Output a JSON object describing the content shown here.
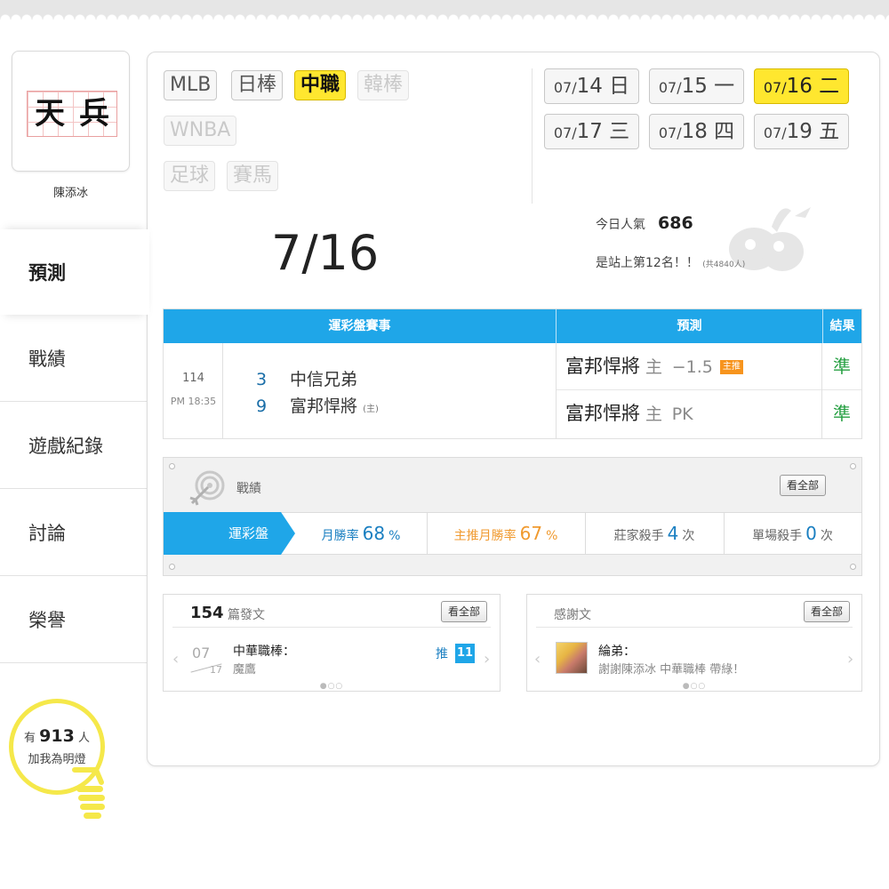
{
  "profile": {
    "avatar_chars": [
      "天",
      "兵"
    ],
    "name": "陳添冰"
  },
  "nav": [
    {
      "label": "預測",
      "active": true
    },
    {
      "label": "戰績"
    },
    {
      "label": "遊戲紀錄"
    },
    {
      "label": "討論"
    },
    {
      "label": "榮譽"
    }
  ],
  "fans": {
    "prefix": "有",
    "count": "913",
    "unit": "人",
    "caption": "加我為明燈"
  },
  "leagues": [
    {
      "label": "MLB",
      "state": "normal"
    },
    {
      "label": "日棒",
      "state": "normal"
    },
    {
      "label": "中職",
      "state": "active"
    },
    {
      "label": "韓棒",
      "state": "disabled"
    },
    {
      "label": "WNBA",
      "state": "disabled"
    },
    {
      "label": "足球",
      "state": "disabled"
    },
    {
      "label": "賽馬",
      "state": "disabled"
    }
  ],
  "dates": [
    {
      "m": "07/",
      "d": "14",
      "w": " 日",
      "active": false
    },
    {
      "m": "07/",
      "d": "15",
      "w": " 一",
      "active": false
    },
    {
      "m": "07/",
      "d": "16",
      "w": " 二",
      "active": true
    },
    {
      "m": "07/",
      "d": "17",
      "w": " 三",
      "active": false
    },
    {
      "m": "07/",
      "d": "18",
      "w": " 四",
      "active": false
    },
    {
      "m": "07/",
      "d": "19",
      "w": " 五",
      "active": false
    }
  ],
  "selected_date": "7/16",
  "popularity": {
    "label": "今日人氣",
    "value": "686",
    "rank_text": "是站上第12名！！",
    "total_text": "(共4840人)"
  },
  "game_table": {
    "headers": {
      "event": "運彩盤賽事",
      "prediction": "預測",
      "result": "結果"
    },
    "game": {
      "id": "114",
      "time": "PM 18:35",
      "away": {
        "score": "3",
        "team": "中信兄弟"
      },
      "home": {
        "score": "9",
        "team": "富邦悍將",
        "tag": "(主)"
      }
    },
    "predictions": [
      {
        "team": "富邦悍將",
        "side": "主",
        "line": "−1.5",
        "badge": "主推",
        "result": "準"
      },
      {
        "team": "富邦悍將",
        "side": "主",
        "line": "PK",
        "badge": "",
        "result": "準"
      }
    ]
  },
  "record": {
    "title": "戰績",
    "view_all": "看全部",
    "tab": "運彩盤",
    "stats": [
      {
        "label": "月勝率",
        "value": "68",
        "unit": "%"
      },
      {
        "label": "主推月勝率",
        "value": "67",
        "unit": "%"
      },
      {
        "label": "莊家殺手",
        "value": "4",
        "unit": "次"
      },
      {
        "label": "單場殺手",
        "value": "0",
        "unit": "次"
      }
    ]
  },
  "posts": {
    "count": "154",
    "unit": "篇發文",
    "view_all": "看全部",
    "item": {
      "month": "07",
      "day": "17",
      "title": "中華職棒：",
      "author": "魔鷹",
      "push_label": "推",
      "push_count": "11"
    },
    "pager": "●○○"
  },
  "thanks": {
    "title": "感謝文",
    "view_all": "看全部",
    "item": {
      "name": "綸弟：",
      "message": "謝謝陳添冰 中華職棒 帶綠！"
    },
    "pager": "●○○"
  },
  "colors": {
    "accent_blue": "#1fa6e8",
    "highlight_yellow": "#ffe72f",
    "result_green": "#27a043",
    "badge_orange": "#f7941d"
  }
}
